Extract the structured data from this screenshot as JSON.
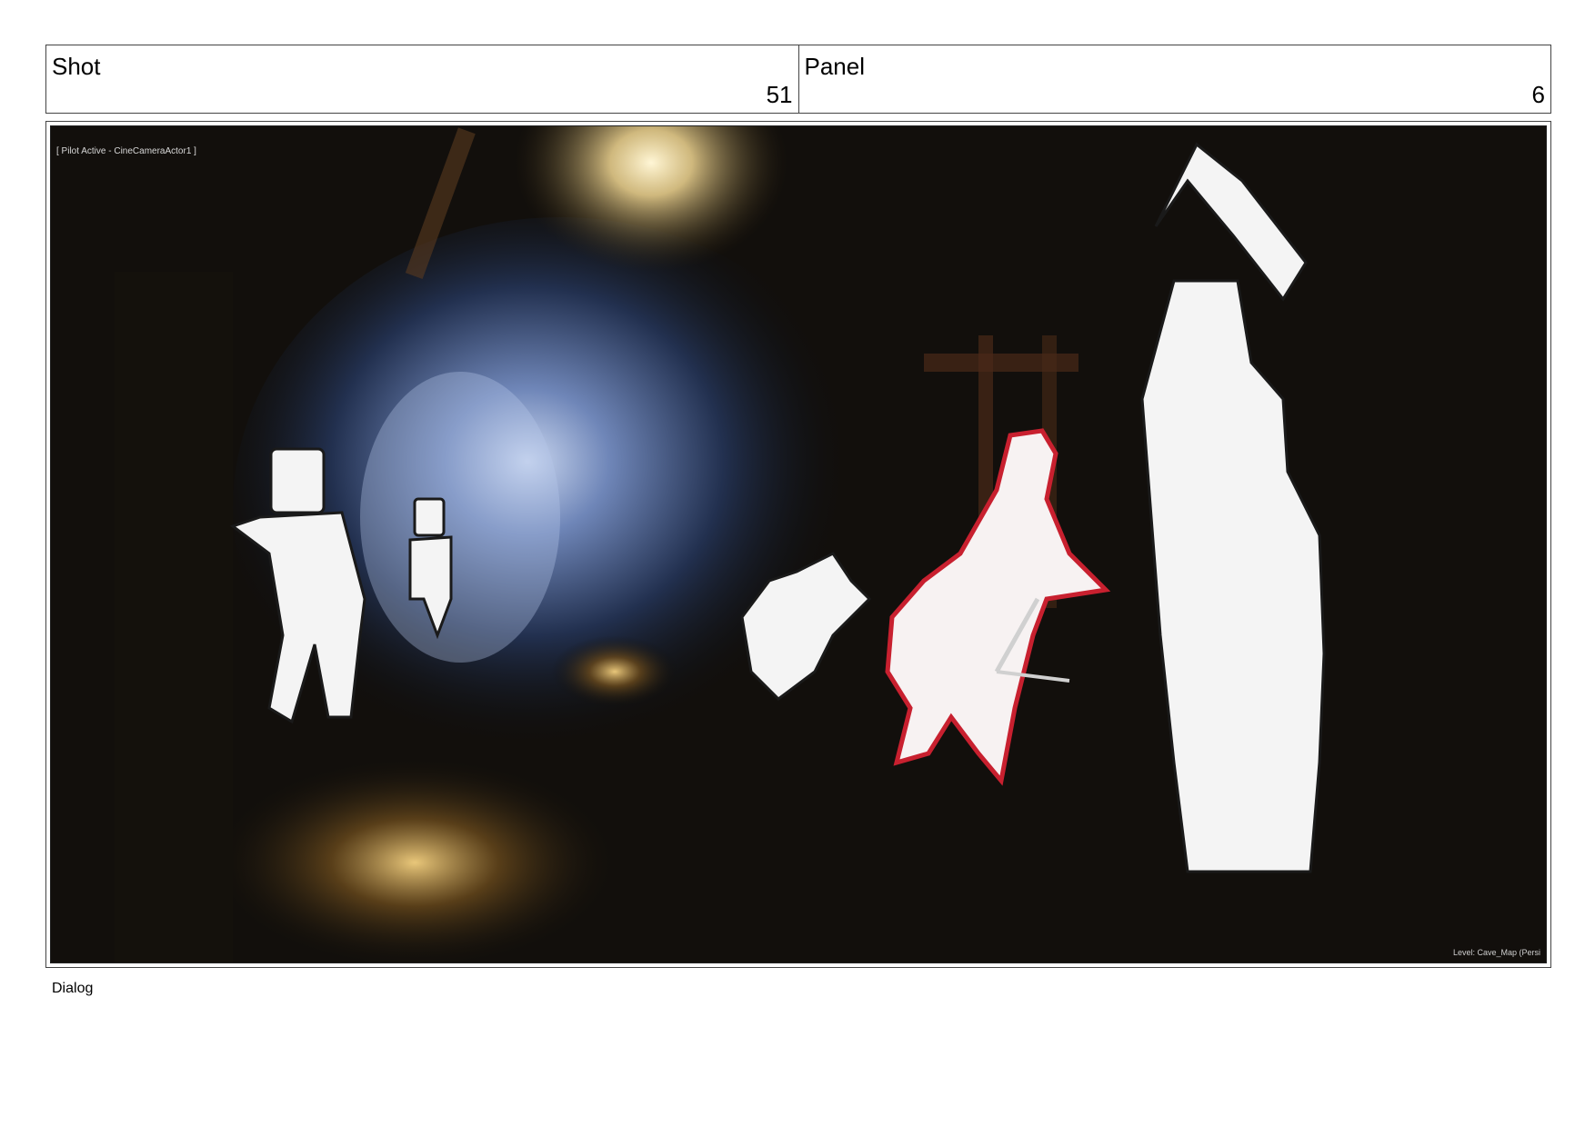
{
  "header": {
    "shot_label": "Shot",
    "shot_number": "51",
    "panel_label": "Panel",
    "panel_number": "6"
  },
  "viewport": {
    "pilot_text": "[ Pilot Active - CineCameraActor1 ]",
    "level_text": "Level: Cave_Map (Persi"
  },
  "dialog_label": "Dialog",
  "colors": {
    "sketch_red": "#c8202f",
    "sketch_white": "#f4f4f4",
    "cave_blue": "#8aa4d6",
    "lamp_glow": "#ffe39a"
  }
}
